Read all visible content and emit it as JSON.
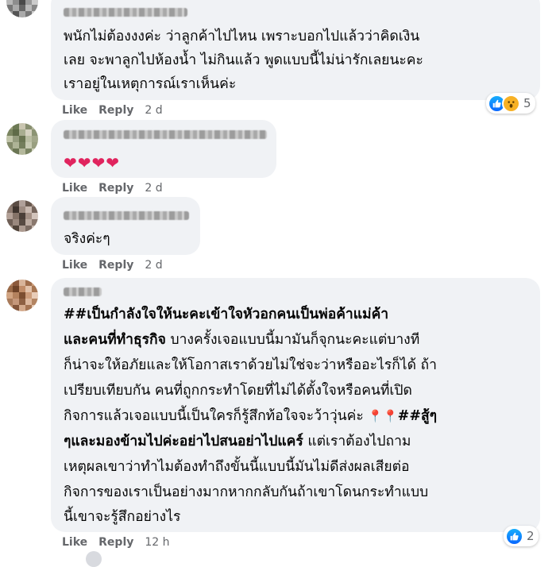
{
  "comments": [
    {
      "lines": [
        "พนักไม่ต้องงงค่ะ ว่าลูกค้าไปไหน เพราะบอกไปแล้วว่าคิดเงิน",
        "เลย จะพาลูกไปห้องน้ำ ไม่กินแล้ว พูดแบบนี้ไม่น่ารักเลยนะคะ",
        "เราอยู่ในเหตุการณ์เราเห็นค่ะ"
      ],
      "like_label": "Like",
      "reply_label": "Reply",
      "time": "2 d",
      "reactions": {
        "icons": [
          "like-icon",
          "wow-icon"
        ],
        "count": "5"
      }
    },
    {
      "text": "❤❤❤❤",
      "like_label": "Like",
      "reply_label": "Reply",
      "time": "2 d"
    },
    {
      "text": "จริงค่ะๆ",
      "like_label": "Like",
      "reply_label": "Reply",
      "time": "2 d"
    },
    {
      "line1_bold": "##เป็นกำลังใจให้นะคะเข้าใจหัวอกคนเป็นพ่อค้าแม่ค้า",
      "line2_bold": "และคนที่ทำธุรกิจ",
      "line2_rest": " บางครั้งเจอแบบนี้มามันก็จุกนะคะแต่บางที",
      "line3": "ก็น่าจะให้อภัยและให้โอกาสเราด้วยไม่ใช่จะว่าหรืออะไรก็ได้ ถ้า",
      "line4": "เปรียบเทียบกัน คนที่ถูกกระทำโดยที่ไม่ได้ตั้งใจหรือคนที่เปิด",
      "line5_text": "กิจการแล้วเจอแบบนี้เป็นใครก็รู้สึกท้อใจจะว้าวุ่นค่ะ ",
      "line5_pins": "📍📍",
      "line5_bold": "##สู้ๆ",
      "line6_bold": "ๆและมองข้ามไปค่ะอย่าไปสนอย่าไปแคร์",
      "line6_rest": " แต่เราต้องไปถาม",
      "line7": "เหตุผลเขาว่าทำไมต้องทำถึงขั้นนี้แบบนี้มันไม่ดีส่งผลเสียต่อ",
      "line8": "กิจการของเราเป็นอย่างมากหากกลับกันถ้าเขาโดนกระทำแบบ",
      "line9": "นี้เขาจะรู้สึกอย่างไร",
      "like_label": "Like",
      "reply_label": "Reply",
      "time": "12 h",
      "reactions": {
        "icons": [
          "like-icon"
        ],
        "count": "2"
      }
    }
  ]
}
